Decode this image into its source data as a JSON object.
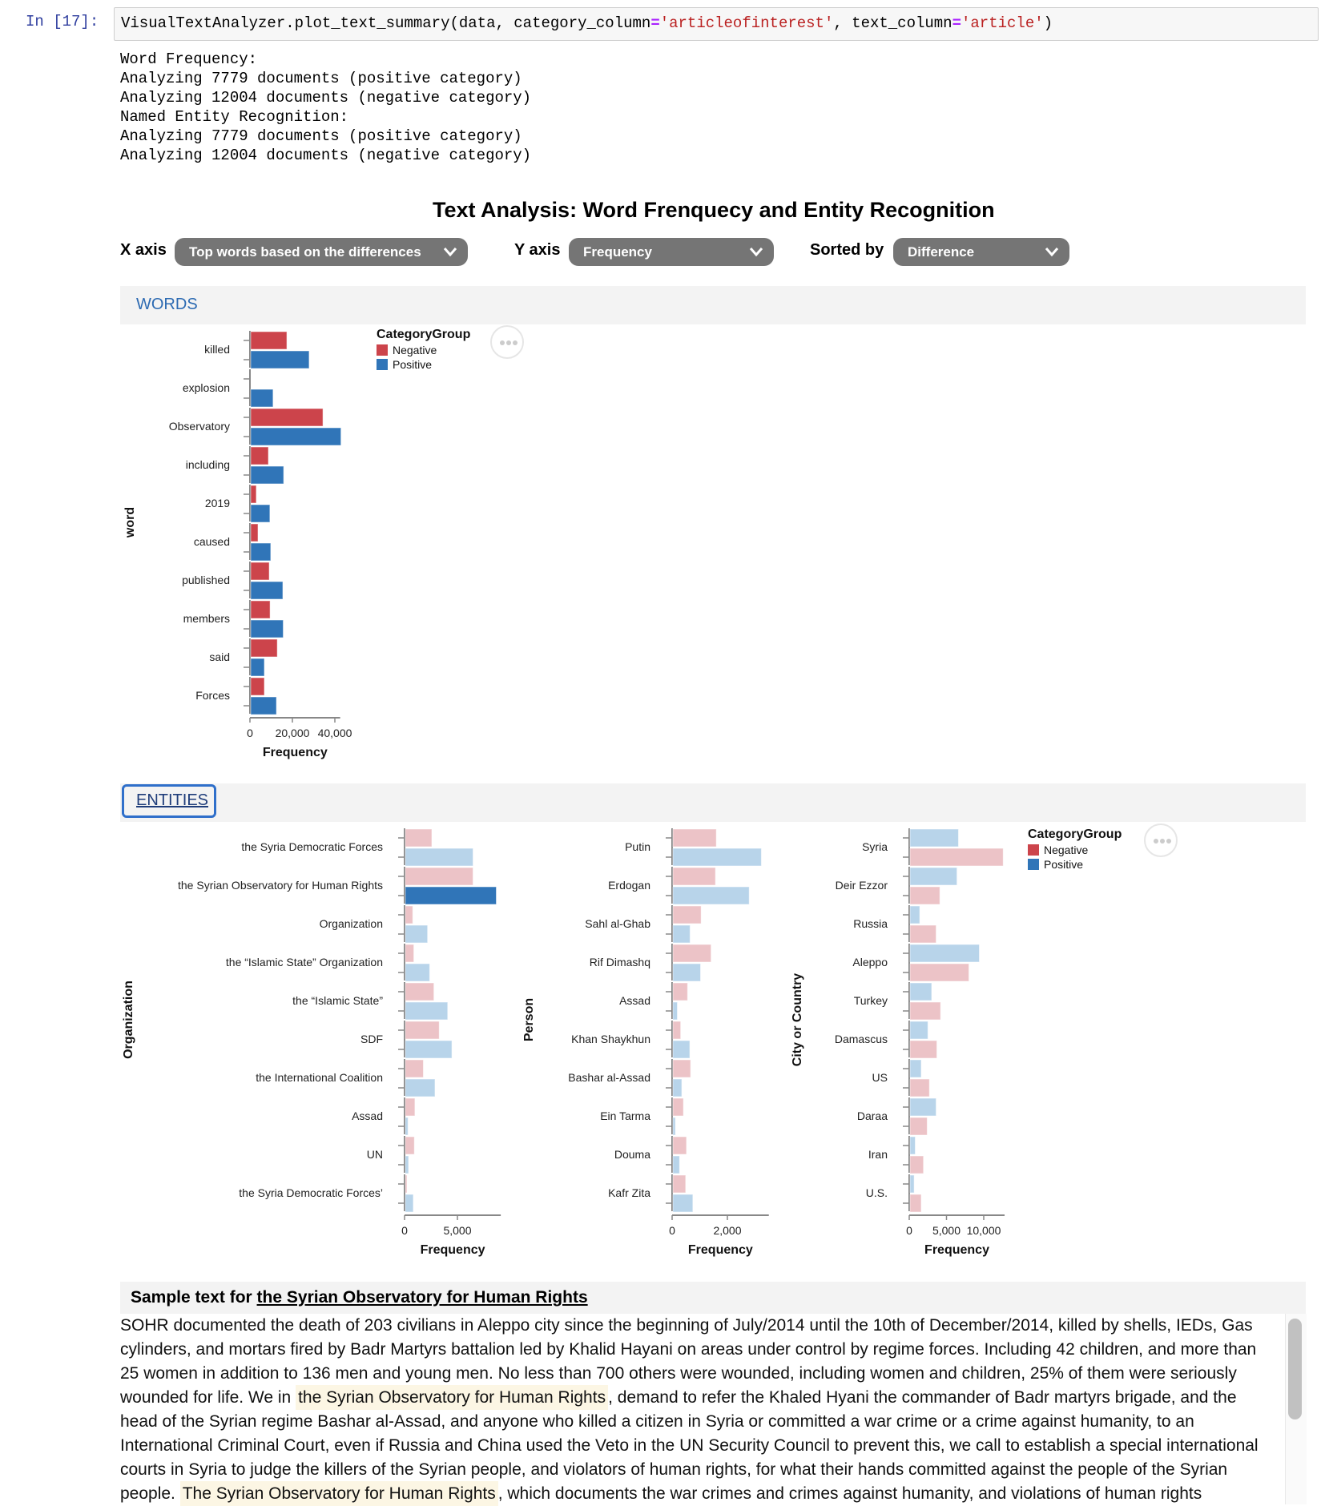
{
  "cell": {
    "prompt": "In [17]:",
    "code": {
      "prefix": "VisualTextAnalyzer.plot_text_summary(data, category_column",
      "eq1": "=",
      "str1": "'articleofinterest'",
      "mid": ", text_column",
      "eq2": "=",
      "str2": "'article'",
      "suffix": ")"
    },
    "output_lines": [
      "Word Frequency:",
      "Analyzing 7779 documents (positive category)",
      "Analyzing 12004 documents (negative category)",
      "Named Entity Recognition:",
      "Analyzing 7779 documents (positive category)",
      "Analyzing 12004 documents (negative category)"
    ]
  },
  "header": {
    "title": "Text Analysis: Word Frenquecy and Entity Recognition"
  },
  "controls": {
    "x_axis": {
      "label": "X axis",
      "value": "Top words based on the differences"
    },
    "y_axis": {
      "label": "Y axis",
      "value": "Frequency"
    },
    "sorted_by": {
      "label": "Sorted by",
      "value": "Difference"
    }
  },
  "sections": {
    "words": "WORDS",
    "entities": "ENTITIES"
  },
  "colors": {
    "negative": "#cc444b",
    "positive": "#3075b8",
    "negative_faded": "#ecc3c7",
    "positive_faded": "#b8d4ea",
    "positive_selected": "#3075b8",
    "axis": "#888888"
  },
  "legend": {
    "title": "CategoryGroup",
    "items": [
      "Negative",
      "Positive"
    ]
  },
  "chart_data": [
    {
      "id": "words",
      "type": "bar",
      "orientation": "horizontal",
      "ylabel": "word",
      "xlabel": "Frequency",
      "xlim": [
        0,
        42500
      ],
      "xticks": [
        0,
        20000,
        40000
      ],
      "xtick_labels": [
        "0",
        "20,000",
        "40,000"
      ],
      "categories": [
        "killed",
        "explosion",
        "Observatory",
        "including",
        "2019",
        "caused",
        "published",
        "members",
        "said",
        "Forces"
      ],
      "series": [
        {
          "name": "Negative",
          "values": [
            17000,
            0,
            34000,
            8300,
            2600,
            3400,
            8700,
            9100,
            12500,
            6400
          ]
        },
        {
          "name": "Positive",
          "values": [
            27500,
            10500,
            42500,
            15500,
            9000,
            9400,
            15100,
            15300,
            6400,
            12100
          ]
        }
      ],
      "legend": "top-right"
    },
    {
      "id": "organization",
      "type": "bar",
      "orientation": "horizontal",
      "ylabel": "Organization",
      "xlabel": "Frequency",
      "xlim": [
        0,
        9100
      ],
      "xticks": [
        0,
        5000
      ],
      "xtick_labels": [
        "0",
        "5,000"
      ],
      "categories": [
        "the Syria Democratic Forces",
        "the Syrian Observatory for Human Rights",
        "Organization",
        "the “Islamic State” Organization",
        "the “Islamic State”",
        "SDF",
        "the International Coalition",
        "Assad",
        "UN",
        "the Syria Democratic Forces’"
      ],
      "series": [
        {
          "name": "Negative",
          "values": [
            2500,
            6400,
            700,
            800,
            2700,
            3200,
            1700,
            900,
            850,
            150
          ]
        },
        {
          "name": "Positive",
          "values": [
            6400,
            8600,
            2100,
            2300,
            4000,
            4400,
            2800,
            250,
            300,
            750
          ]
        }
      ],
      "selected": {
        "category": "the Syrian Observatory for Human Rights",
        "series": "Positive"
      }
    },
    {
      "id": "person",
      "type": "bar",
      "orientation": "horizontal",
      "ylabel": "Person",
      "xlabel": "Frequency",
      "xlim": [
        0,
        3500
      ],
      "xticks": [
        0,
        2000
      ],
      "xtick_labels": [
        "0",
        "2,000"
      ],
      "categories": [
        "Putin",
        "Erdogan",
        "Sahl al-Ghab",
        "Rif Dimashq",
        "Assad",
        "Khan Shaykhun",
        "Bashar al-Assad",
        "Ein Tarma",
        "Douma",
        "Kafr Zita"
      ],
      "series": [
        {
          "name": "Negative",
          "values": [
            1570,
            1540,
            1020,
            1380,
            530,
            280,
            640,
            380,
            490,
            460
          ]
        },
        {
          "name": "Positive",
          "values": [
            3200,
            2760,
            620,
            1000,
            160,
            610,
            320,
            90,
            240,
            720
          ]
        }
      ]
    },
    {
      "id": "city",
      "type": "bar",
      "orientation": "horizontal",
      "ylabel": "City or Country",
      "xlabel": "Frequency",
      "xlim": [
        0,
        12800
      ],
      "xticks": [
        0,
        5000,
        10000
      ],
      "xtick_labels": [
        "0",
        "5,000",
        "10,000"
      ],
      "categories": [
        "Syria",
        "Deir Ezzor",
        "Russia",
        "Aleppo",
        "Turkey",
        "Damascus",
        "US",
        "Daraa",
        "Iran",
        "U.S."
      ],
      "series_order": [
        "Positive",
        "Negative"
      ],
      "series": [
        {
          "name": "Negative",
          "values": [
            12500,
            4000,
            3500,
            7900,
            4100,
            3600,
            2600,
            2300,
            1800,
            1500
          ]
        },
        {
          "name": "Positive",
          "values": [
            6500,
            6300,
            1300,
            9300,
            2900,
            2400,
            1500,
            3500,
            700,
            550
          ]
        }
      ],
      "legend": "top-right"
    }
  ],
  "sample": {
    "title_prefix": "Sample text for ",
    "entity": "the Syrian Observatory for Human Rights",
    "segments": [
      {
        "text": "SOHR documented the death of 203 civilians in Aleppo city since the beginning of July/2014 until the 10th of December/2014, killed by shells, IEDs, Gas cylinders, and mortars fired by Badr Martyrs battalion led by Khalid Hayani on areas under control by regime forces. Including 42 children, and more than 25 women in addition to 136 men and young men. No less than 700 others were wounded, including women and children, 25% of them were seriously wounded for life. We in ",
        "highlight": false
      },
      {
        "text": "the Syrian Observatory for Human Rights",
        "highlight": true
      },
      {
        "text": ", demand to refer the Khaled Hyani the commander of Badr martyrs brigade, and the head of the Syrian regime Bashar al-Assad, and anyone who killed a citizen in Syria or committed a war crime or a crime against humanity, to an International Criminal Court, even if Russia and China used the Veto in the UN Security Council to prevent this, we call to establish a special international courts in Syria to judge the killers of the Syrian people, and violators of human rights, for what their hands committed against the people of the Syrian people. ",
        "highlight": false
      },
      {
        "text": "The Syrian Observatory for Human Rights",
        "highlight": true
      },
      {
        "text": ", which documents the war crimes and crimes against humanity, and violations of human rights",
        "highlight": false
      }
    ]
  }
}
